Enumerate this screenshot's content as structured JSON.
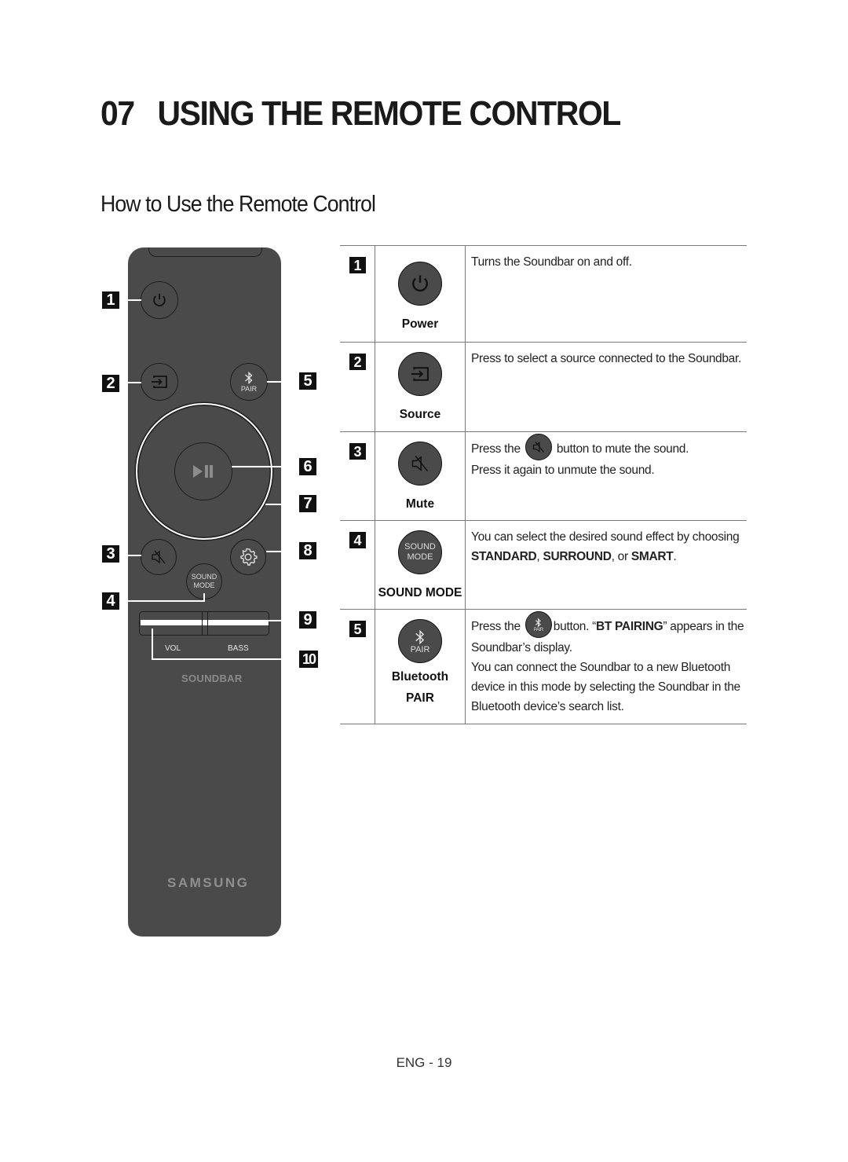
{
  "header": {
    "chapter_number": "07",
    "chapter_title": "USING THE REMOTE CONTROL",
    "section_title": "How to Use the Remote Control"
  },
  "remote": {
    "callouts": [
      "1",
      "2",
      "3",
      "4",
      "5",
      "6",
      "7",
      "8",
      "9",
      "10"
    ],
    "buttons": {
      "power_icon": "power-icon",
      "source_icon": "source-icon",
      "pair_label": "PAIR",
      "play_pause_icon": "play-pause-icon",
      "mute_icon": "mute-icon",
      "settings_icon": "gear-icon",
      "sound_mode_line1": "SOUND",
      "sound_mode_line2": "MODE"
    },
    "rocker_labels": {
      "vol": "VOL",
      "bass": "BASS"
    },
    "model_text": "SOUNDBAR",
    "brand": "SAMSUNG",
    "colors": {
      "body": "#4a4a4a",
      "outline": "#1e1e1e"
    }
  },
  "table": {
    "rows": [
      {
        "number": "1",
        "icon": "power-icon",
        "caption": "Power",
        "description": "Turns the Soundbar on and off."
      },
      {
        "number": "2",
        "icon": "source-icon",
        "caption": "Source",
        "description": "Press to select a source connected to the Soundbar."
      },
      {
        "number": "3",
        "icon": "mute-icon",
        "caption": "Mute",
        "desc_part1": "Press the",
        "desc_part2": "button to mute the sound.",
        "desc_line2": "Press it again to unmute the sound."
      },
      {
        "number": "4",
        "icon": "sound-mode-icon",
        "icon_text1": "SOUND",
        "icon_text2": "MODE",
        "caption": "SOUND MODE",
        "desc_part1": "You can select the desired sound effect by choosing",
        "opt1": "STANDARD",
        "sep1": ", ",
        "opt2": "SURROUND",
        "sep2": ", or ",
        "opt3": "SMART",
        "end": "."
      },
      {
        "number": "5",
        "icon": "bluetooth-pair-icon",
        "icon_text": "PAIR",
        "caption_line1": "Bluetooth",
        "caption_line2": "PAIR",
        "desc_part1": "Press the",
        "desc_part2": "button. “",
        "desc_bold": "BT PAIRING",
        "desc_part3": "” appears in the Soundbar’s display.",
        "desc_para2": "You can connect the Soundbar to a new Bluetooth device in this mode by selecting the Soundbar in the Bluetooth device’s search list."
      }
    ]
  },
  "footer": {
    "page_label": "ENG - 19"
  }
}
